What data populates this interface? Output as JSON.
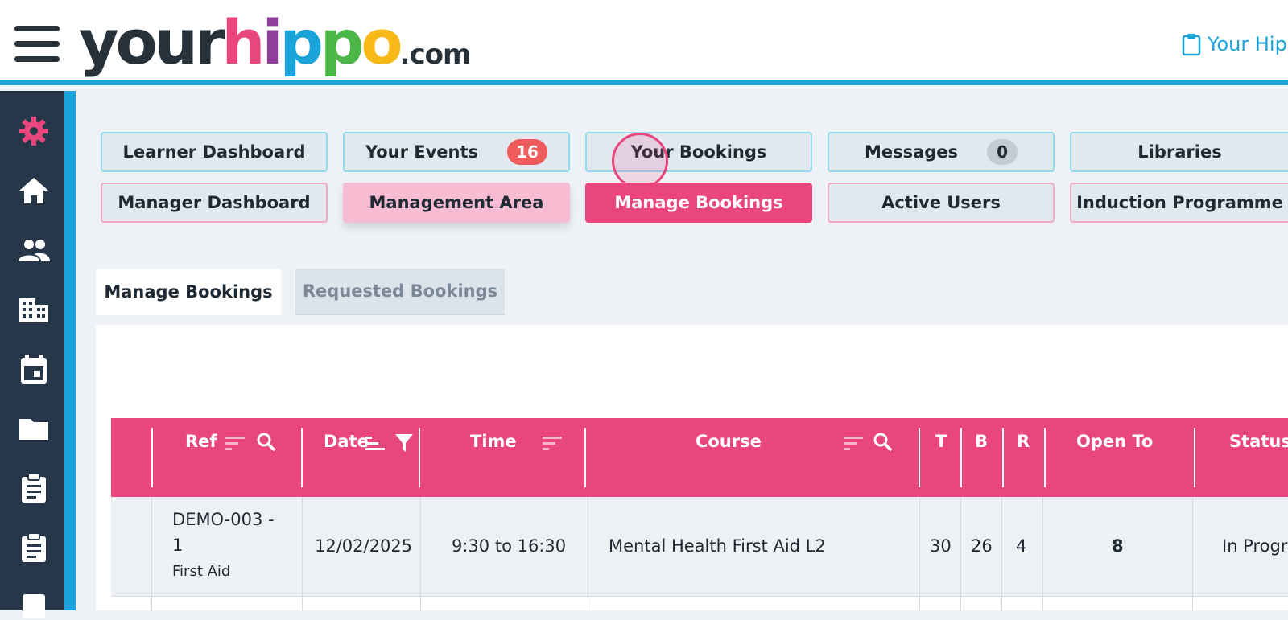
{
  "header": {
    "logo": {
      "part1": "your",
      "h": "h",
      "i": "i",
      "p1": "p",
      "p2": "p",
      "o": "o",
      "part3": ".com"
    },
    "link_label": "Your Hip"
  },
  "colors": {
    "brand_pink": "#e8467c",
    "brand_blue": "#1aa3d8",
    "sidebar": "#27374a"
  },
  "sidebar": {
    "items": [
      {
        "icon": "gear-icon"
      },
      {
        "icon": "home-icon"
      },
      {
        "icon": "people-icon"
      },
      {
        "icon": "building-icon"
      },
      {
        "icon": "calendar-icon"
      },
      {
        "icon": "folder-icon"
      },
      {
        "icon": "clipboard-icon"
      },
      {
        "icon": "clipboard-icon"
      }
    ]
  },
  "nav": {
    "row1": [
      {
        "label": "Learner Dashboard"
      },
      {
        "label": "Your Events",
        "badge": "16"
      },
      {
        "label": "Your Bookings"
      },
      {
        "label": "Messages",
        "badge": "0"
      },
      {
        "label": "Libraries"
      }
    ],
    "row2": [
      {
        "label": "Manager Dashboard"
      },
      {
        "label": "Management Area"
      },
      {
        "label": "Manage Bookings"
      },
      {
        "label": "Active Users"
      },
      {
        "label": "Induction Programme"
      }
    ]
  },
  "tabs": [
    {
      "label": "Manage Bookings",
      "active": true
    },
    {
      "label": "Requested Bookings",
      "active": false
    }
  ],
  "table": {
    "columns": [
      "Ref",
      "Date",
      "Time",
      "Course",
      "T",
      "B",
      "R",
      "Open To",
      "Status"
    ],
    "rows": [
      {
        "ref_line1": "DEMO-003 -",
        "ref_line2": "1",
        "ref_sub": "First Aid",
        "date": "12/02/2025",
        "time": "9:30 to 16:30",
        "course": "Mental Health First Aid L2",
        "t": "30",
        "b": "26",
        "r": "4",
        "open_to": "8",
        "status": "In Progr"
      }
    ]
  }
}
